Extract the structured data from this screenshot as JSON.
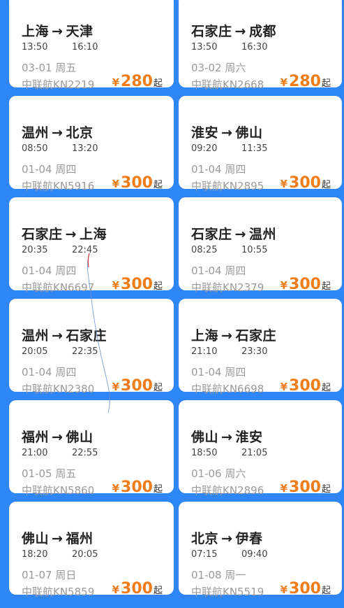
{
  "currency_symbol": "¥",
  "price_suffix": "起",
  "arrow": "→",
  "colors": {
    "background": "#2f86f6",
    "card": "#ffffff",
    "price": "#f07d1a"
  },
  "flights": [
    {
      "from": "上海",
      "to": "天津",
      "dep": "13:50",
      "arr": "16:10",
      "date": "03-01 周五",
      "flight": "中联航KN2219",
      "price": "280"
    },
    {
      "from": "石家庄",
      "to": "成都",
      "dep": "13:50",
      "arr": "16:30",
      "date": "03-02 周六",
      "flight": "中联航KN2668",
      "price": "280"
    },
    {
      "from": "温州",
      "to": "北京",
      "dep": "08:50",
      "arr": "13:20",
      "date": "01-04 周四",
      "flight": "中联航KN5916",
      "price": "300"
    },
    {
      "from": "淮安",
      "to": "佛山",
      "dep": "09:20",
      "arr": "11:35",
      "date": "01-04 周四",
      "flight": "中联航KN2895",
      "price": "300"
    },
    {
      "from": "石家庄",
      "to": "上海",
      "dep": "20:35",
      "arr": "22:45",
      "date": "01-04 周四",
      "flight": "中联航KN6697",
      "price": "300"
    },
    {
      "from": "石家庄",
      "to": "温州",
      "dep": "08:25",
      "arr": "10:55",
      "date": "01-04 周四",
      "flight": "中联航KN2379",
      "price": "300"
    },
    {
      "from": "温州",
      "to": "石家庄",
      "dep": "20:05",
      "arr": "22:35",
      "date": "01-04 周四",
      "flight": "中联航KN2380",
      "price": "300"
    },
    {
      "from": "上海",
      "to": "石家庄",
      "dep": "21:10",
      "arr": "23:30",
      "date": "01-04 周四",
      "flight": "中联航KN6698",
      "price": "300"
    },
    {
      "from": "福州",
      "to": "佛山",
      "dep": "21:00",
      "arr": "22:55",
      "date": "01-05 周五",
      "flight": "中联航KN5860",
      "price": "300"
    },
    {
      "from": "佛山",
      "to": "淮安",
      "dep": "18:50",
      "arr": "21:05",
      "date": "01-06 周六",
      "flight": "中联航KN2896",
      "price": "300"
    },
    {
      "from": "佛山",
      "to": "福州",
      "dep": "18:20",
      "arr": "20:05",
      "date": "01-07 周日",
      "flight": "中联航KN5859",
      "price": "300"
    },
    {
      "from": "北京",
      "to": "伊春",
      "dep": "07:15",
      "arr": "09:40",
      "date": "01-08 周一",
      "flight": "中联航KN5519",
      "price": "300"
    }
  ]
}
